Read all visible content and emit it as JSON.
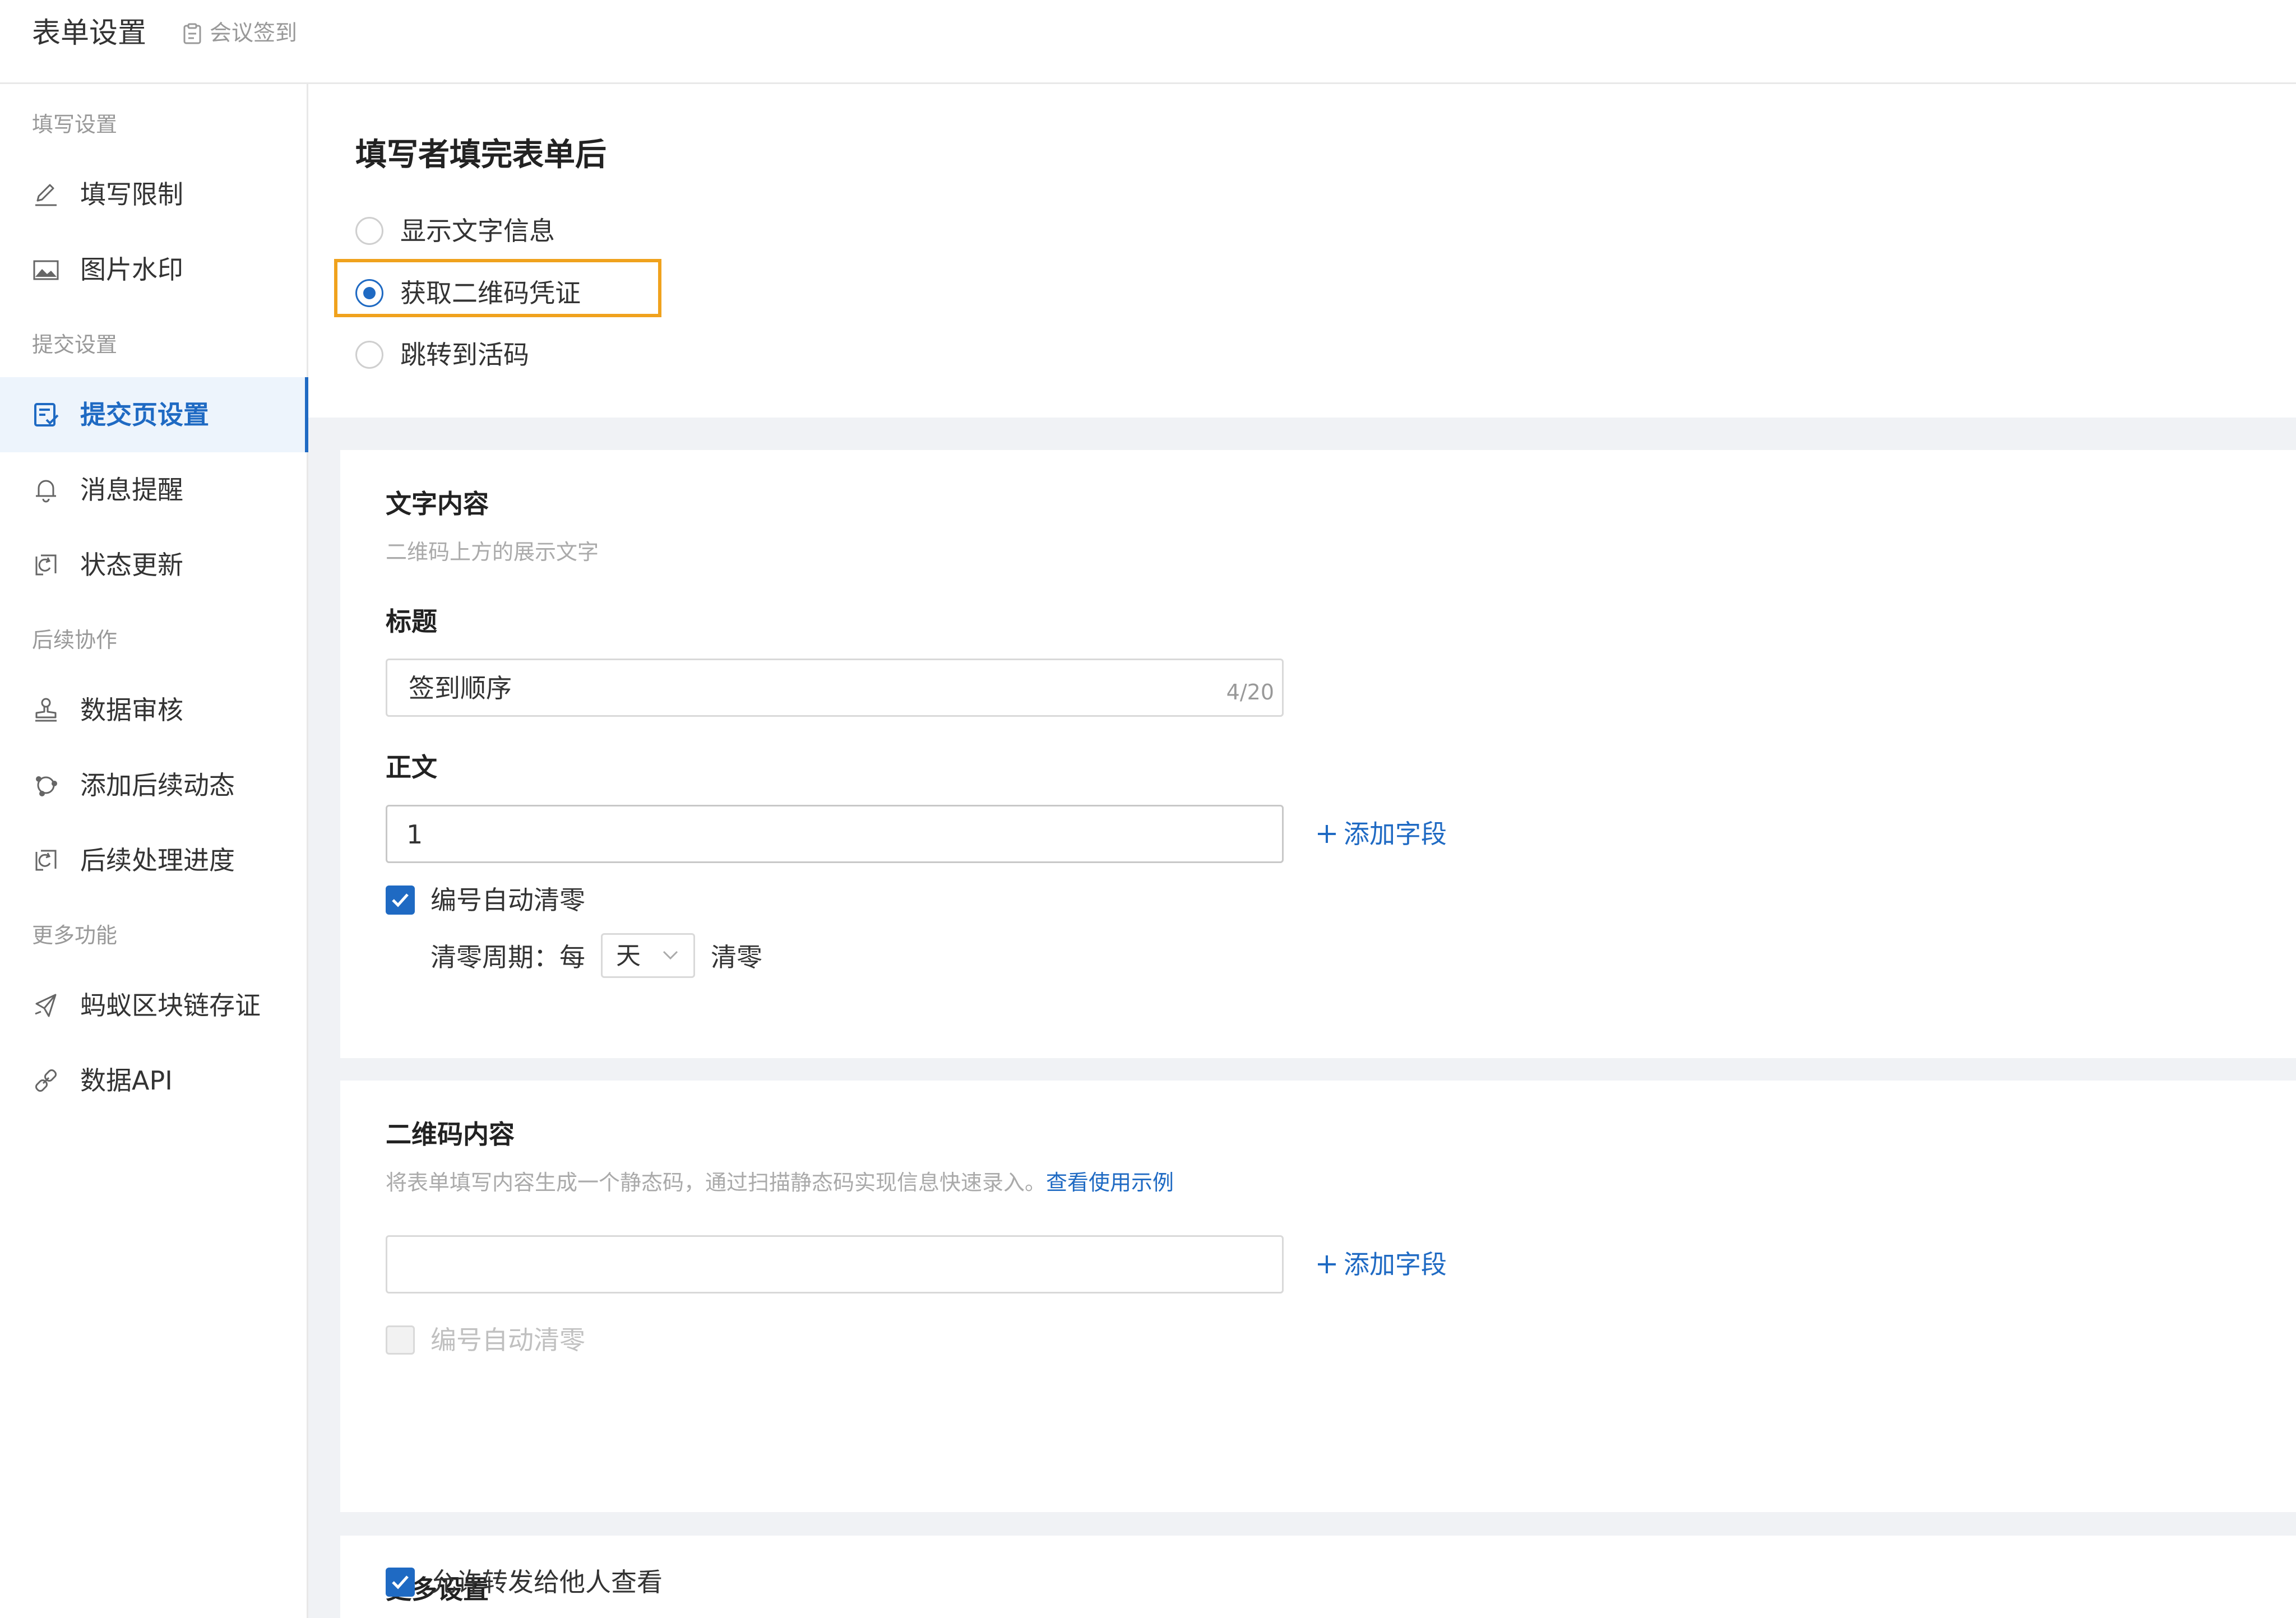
{
  "header": {
    "title": "表单设置",
    "breadcrumb": "会议签到"
  },
  "sidebar": {
    "groups": [
      {
        "label": "填写设置",
        "items": [
          {
            "label": "填写限制",
            "icon": "pen-icon"
          },
          {
            "label": "图片水印",
            "icon": "image-icon"
          }
        ]
      },
      {
        "label": "提交设置",
        "items": [
          {
            "label": "提交页设置",
            "icon": "submit-page-icon",
            "active": true
          },
          {
            "label": "消息提醒",
            "icon": "bell-icon"
          },
          {
            "label": "状态更新",
            "icon": "refresh-icon"
          }
        ]
      },
      {
        "label": "后续协作",
        "items": [
          {
            "label": "数据审核",
            "icon": "stamp-icon"
          },
          {
            "label": "添加后续动态",
            "icon": "share-icon"
          },
          {
            "label": "后续处理进度",
            "icon": "progress-icon"
          }
        ]
      },
      {
        "label": "更多功能",
        "items": [
          {
            "label": "蚂蚁区块链存证",
            "icon": "blockchain-icon"
          },
          {
            "label": "数据API",
            "icon": "link-icon"
          }
        ]
      }
    ]
  },
  "after_submit": {
    "heading": "填写者填完表单后",
    "options": [
      {
        "label": "显示文字信息",
        "selected": false
      },
      {
        "label": "获取二维码凭证",
        "selected": true
      },
      {
        "label": "跳转到活码",
        "selected": false
      }
    ]
  },
  "text_content": {
    "title": "文字内容",
    "desc": "二维码上方的展示文字",
    "title_label": "标题",
    "title_value": "签到顺序",
    "title_count": "4/20",
    "body_label": "正文",
    "body_value": "1",
    "add_field": "添加字段",
    "auto_reset_label": "编号自动清零",
    "auto_reset_checked": true,
    "period_prefix": "清零周期：每",
    "period_value": "天",
    "period_suffix": "清零"
  },
  "qr_content": {
    "title": "二维码内容",
    "desc": "将表单填写内容生成一个静态码，通过扫描静态码实现信息快速录入。",
    "desc_link": "查看使用示例",
    "value": "",
    "add_field": "添加字段",
    "auto_reset_label": "编号自动清零",
    "auto_reset_checked": false
  },
  "more_settings": {
    "title": "更多设置",
    "allow_forward_label": "允许转发给他人查看",
    "allow_forward_checked": true
  },
  "colors": {
    "accent": "#1f6ac3",
    "highlight": "#f0a21d",
    "page_bg": "#f0f2f5"
  }
}
